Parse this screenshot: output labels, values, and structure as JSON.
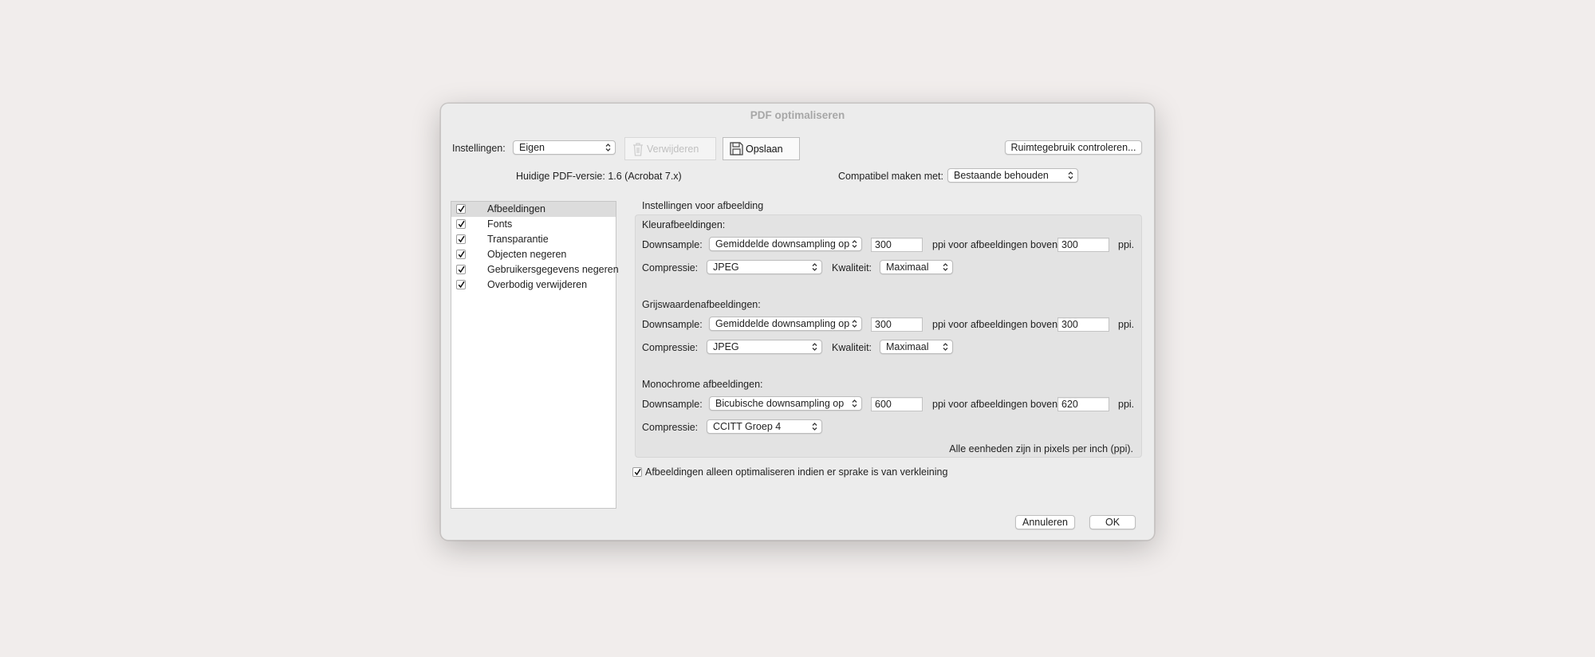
{
  "window": {
    "title": "PDF optimaliseren"
  },
  "toolbar": {
    "settings_label": "Instellingen:",
    "settings_value": "Eigen",
    "delete_label": "Verwijderen",
    "save_label": "Opslaan",
    "audit_label": "Ruimtegebruik controleren..."
  },
  "version": {
    "current_label": "Huidige PDF-versie: 1.6 (Acrobat 7.x)",
    "compat_label": "Compatibel maken met:",
    "compat_value": "Bestaande behouden"
  },
  "sidebar": {
    "items": [
      {
        "label": "Afbeeldingen",
        "checked": true,
        "selected": true
      },
      {
        "label": "Fonts",
        "checked": true
      },
      {
        "label": "Transparantie",
        "checked": true
      },
      {
        "label": "Objecten negeren",
        "checked": true
      },
      {
        "label": "Gebruikersgegevens negeren",
        "checked": true
      },
      {
        "label": "Overbodig verwijderen",
        "checked": true
      }
    ]
  },
  "panel": {
    "title": "Instellingen voor afbeelding",
    "downsample_label": "Downsample:",
    "compression_label": "Compressie:",
    "quality_label": "Kwaliteit:",
    "ppi_above_label": "ppi voor afbeeldingen boven",
    "ppi_label": "ppi.",
    "color": {
      "title": "Kleurafbeeldingen:",
      "downsample": "Gemiddelde downsampling op",
      "ppi": "300",
      "above": "300",
      "compression": "JPEG",
      "quality": "Maximaal"
    },
    "gray": {
      "title": "Grijswaardenafbeeldingen:",
      "downsample": "Gemiddelde downsampling op",
      "ppi": "300",
      "above": "300",
      "compression": "JPEG",
      "quality": "Maximaal"
    },
    "mono": {
      "title": "Monochrome afbeeldingen:",
      "downsample": "Bicubische downsampling op",
      "ppi": "600",
      "above": "620",
      "compression": "CCITT Groep 4"
    },
    "units_note": "Alle eenheden zijn in pixels per inch (ppi).",
    "optimize_only_label": "Afbeeldingen alleen optimaliseren indien er sprake is van verkleining",
    "optimize_only_checked": true
  },
  "footer": {
    "cancel_label": "Annuleren",
    "ok_label": "OK"
  }
}
